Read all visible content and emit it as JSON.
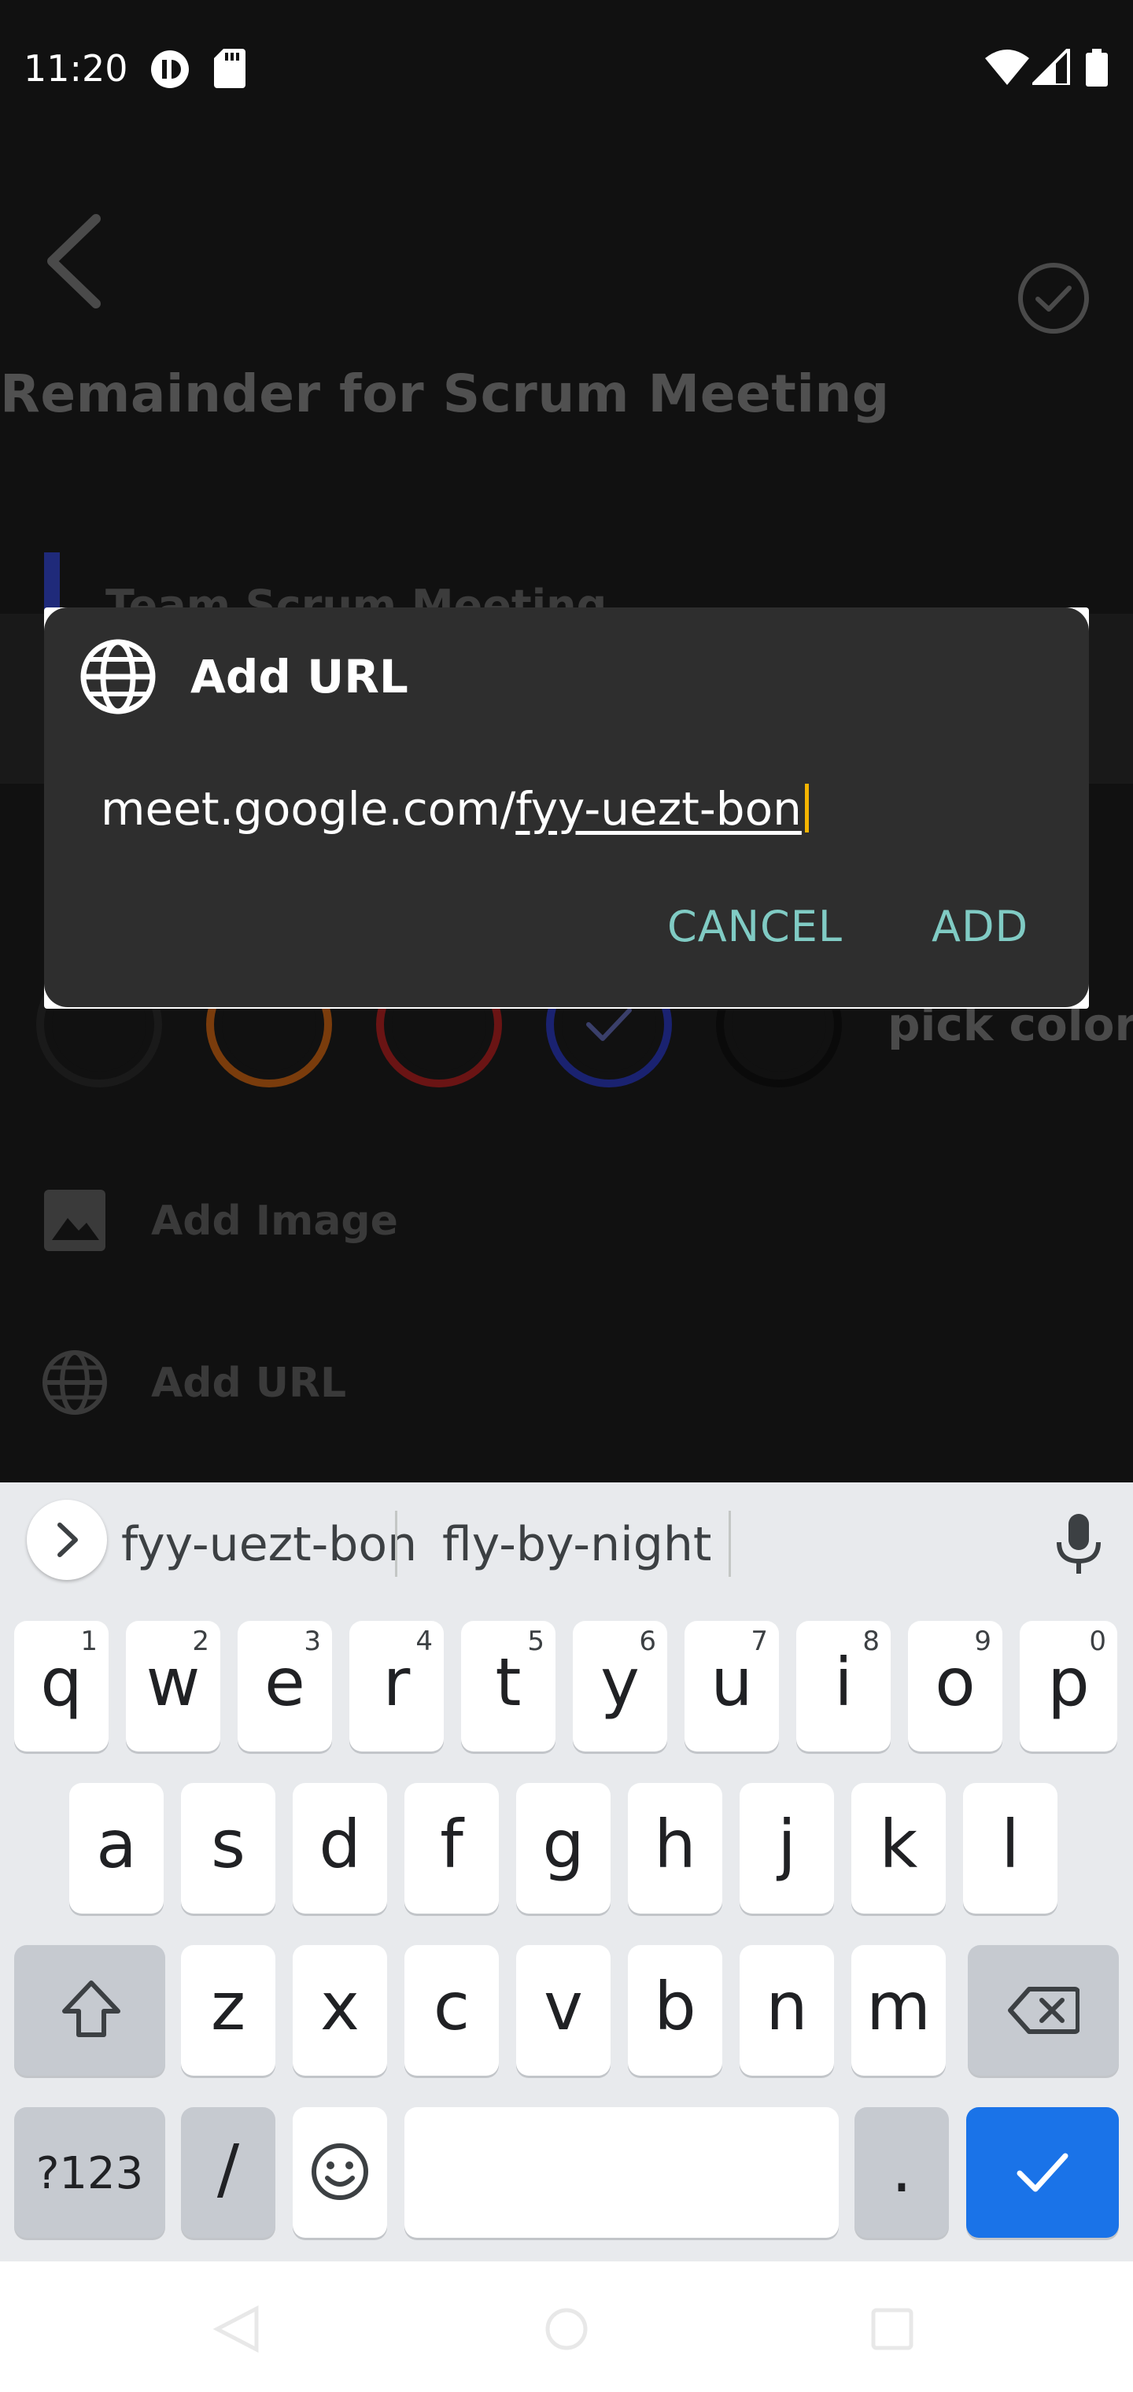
{
  "status_bar": {
    "time": "11:20"
  },
  "screen": {
    "title": "Remainder for Scrum Meeting",
    "note_title": "Team Scrum Meeting",
    "pick_color_label": "pick color",
    "add_image_label": "Add Image",
    "add_url_label": "Add URL",
    "colors": [
      "#111111",
      "#b35a16",
      "#9e1f1f",
      "#1f2a9e",
      "#000000"
    ],
    "selected_color_index": 3
  },
  "dialog": {
    "title": "Add URL",
    "url_prefix": "meet.google.com/",
    "url_composing": "fyy-uezt-bon",
    "cancel_label": "CANCEL",
    "add_label": "ADD",
    "accent_color": "#80cbc4"
  },
  "keyboard": {
    "suggestions": [
      "fyy-uezt-bon",
      "fly-by-night"
    ],
    "row1": [
      {
        "ch": "q",
        "hint": "1"
      },
      {
        "ch": "w",
        "hint": "2"
      },
      {
        "ch": "e",
        "hint": "3"
      },
      {
        "ch": "r",
        "hint": "4"
      },
      {
        "ch": "t",
        "hint": "5"
      },
      {
        "ch": "y",
        "hint": "6"
      },
      {
        "ch": "u",
        "hint": "7"
      },
      {
        "ch": "i",
        "hint": "8"
      },
      {
        "ch": "o",
        "hint": "9"
      },
      {
        "ch": "p",
        "hint": "0"
      }
    ],
    "row2": [
      "a",
      "s",
      "d",
      "f",
      "g",
      "h",
      "j",
      "k",
      "l"
    ],
    "row3": [
      "z",
      "x",
      "c",
      "v",
      "b",
      "n",
      "m"
    ],
    "symbols_label": "?123",
    "slash_label": "/",
    "period_label": ".",
    "enter_color": "#1a73e8"
  }
}
